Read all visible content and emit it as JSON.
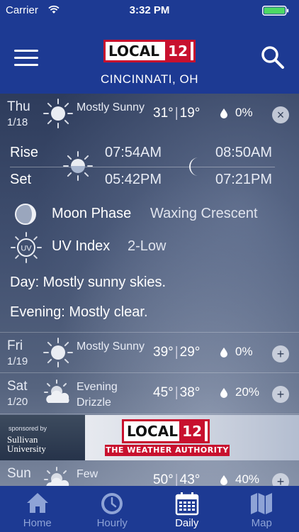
{
  "status_bar": {
    "carrier": "Carrier",
    "time": "3:32 PM"
  },
  "header": {
    "logo_text": "LOCAL",
    "logo_number": "12",
    "location": "CINCINNATI, OH"
  },
  "days": [
    {
      "day": "Thu",
      "date": "1/18",
      "condition_icon": "sun-icon",
      "condition": "Mostly Sunny",
      "high": "31°",
      "low": "19°",
      "precip": "0%",
      "toggle": "×",
      "expanded": true
    },
    {
      "day": "Fri",
      "date": "1/19",
      "condition_icon": "sun-icon",
      "condition": "Mostly Sunny",
      "high": "39°",
      "low": "29°",
      "precip": "0%",
      "toggle": "+"
    },
    {
      "day": "Sat",
      "date": "1/20",
      "condition_icon": "partly-cloudy-icon",
      "condition": "Evening Drizzle",
      "high": "45°",
      "low": "38°",
      "precip": "20%",
      "toggle": "+"
    },
    {
      "day": "Sun",
      "date": "",
      "condition_icon": "partly-cloudy-icon",
      "condition": "Few",
      "high": "50°",
      "low": "43°",
      "precip": "40%",
      "toggle": "+"
    }
  ],
  "details": {
    "rise_label": "Rise",
    "set_label": "Set",
    "sunrise": "07:54AM",
    "sunset": "05:42PM",
    "moonrise": "08:50AM",
    "moonset": "07:21PM",
    "moon_phase_label": "Moon Phase",
    "moon_phase_value": "Waxing Crescent",
    "uv_label": "UV Index",
    "uv_value": "2-Low",
    "uv_icon_text": "UV",
    "day_summary": "Day: Mostly sunny skies.",
    "evening_summary": "Evening: Mostly clear."
  },
  "ad": {
    "sponsor_text": "sponsored by",
    "sponsor_name": "Sullivan University",
    "logo_text": "LOCAL",
    "logo_number": "12",
    "tagline": "THE WEATHER AUTHORITY"
  },
  "tabs": [
    {
      "label": "Home",
      "icon": "home-icon",
      "active": false
    },
    {
      "label": "Hourly",
      "icon": "clock-icon",
      "active": false
    },
    {
      "label": "Daily",
      "icon": "calendar-icon",
      "active": true
    },
    {
      "label": "Map",
      "icon": "map-icon",
      "active": false
    }
  ],
  "colors": {
    "brand_blue": "#1d3a93",
    "brand_red": "#c8102e",
    "inactive_tab": "#8ea3d6"
  }
}
